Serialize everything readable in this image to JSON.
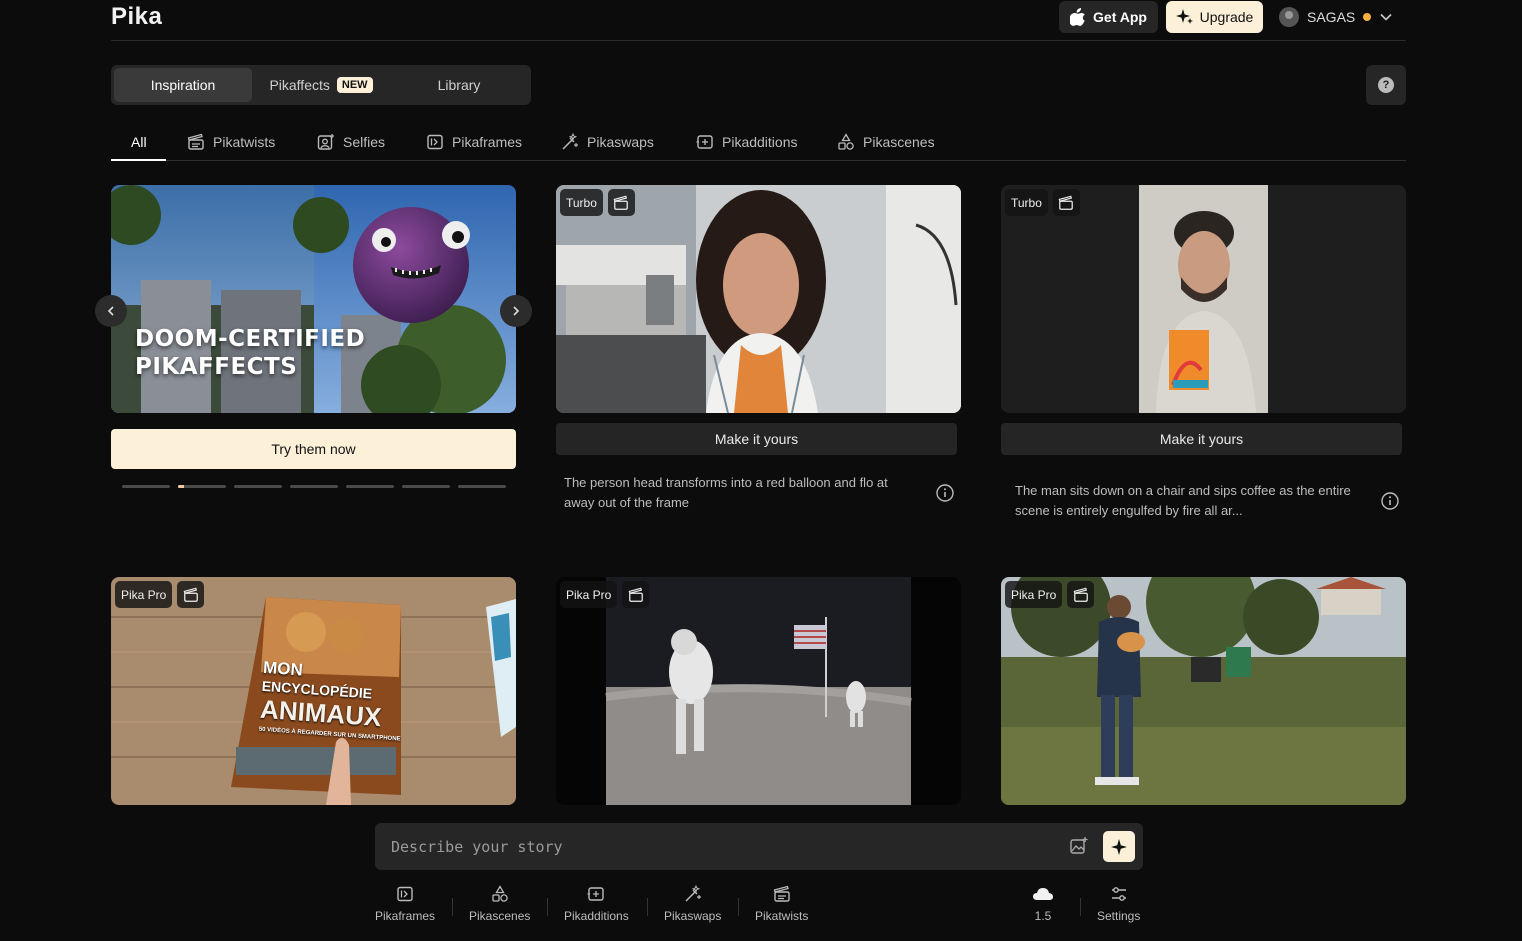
{
  "header": {
    "logo": "Pika",
    "get_app": "Get App",
    "upgrade": "Upgrade",
    "username": "SAGAS"
  },
  "main_tabs": [
    {
      "label": "Inspiration",
      "active": true
    },
    {
      "label": "Pikaffects",
      "badge": "NEW"
    },
    {
      "label": "Library"
    }
  ],
  "help": "?",
  "categories": [
    {
      "label": "All",
      "active": true
    },
    {
      "label": "Pikatwists",
      "icon": "clapper-icon"
    },
    {
      "label": "Selfies",
      "icon": "selfie-icon"
    },
    {
      "label": "Pikaframes",
      "icon": "frames-icon"
    },
    {
      "label": "Pikaswaps",
      "icon": "swap-wand-icon"
    },
    {
      "label": "Pikadditions",
      "icon": "additions-icon"
    },
    {
      "label": "Pikascenes",
      "icon": "shapes-icon"
    }
  ],
  "promo": {
    "title_line1": "DOOM-CERTIFIED",
    "title_line2": "PIKAFFECTS",
    "cta": "Try them now",
    "slide_count": 7,
    "active_slide": 2
  },
  "cards": [
    {
      "tag": "Turbo",
      "action": "Make it yours",
      "description": "The person head transforms into a red balloon and flo at away out of the frame"
    },
    {
      "tag": "Turbo",
      "action": "Make it yours",
      "description": "The man sits down on a chair and sips coffee as the entire scene is entirely engulfed by fire all ar..."
    },
    {
      "tag": "Pika Pro"
    },
    {
      "tag": "Pika Pro"
    },
    {
      "tag": "Pika Pro"
    }
  ],
  "book": {
    "line1": "MON",
    "line2": "ENCYCLOPÉDIE",
    "line3": "ANIMAUX",
    "line4": "50 VIDÉOS À REGARDER SUR UN SMARTPHONE"
  },
  "prompt": {
    "placeholder": "Describe your story"
  },
  "tools": [
    {
      "label": "Pikaframes",
      "icon": "frames-icon"
    },
    {
      "label": "Pikascenes",
      "icon": "shapes-icon"
    },
    {
      "label": "Pikadditions",
      "icon": "additions-icon"
    },
    {
      "label": "Pikaswaps",
      "icon": "swap-wand-icon"
    },
    {
      "label": "Pikatwists",
      "icon": "clapper-icon"
    }
  ],
  "model": {
    "label": "1.5",
    "icon": "cloud-icon"
  },
  "settings": {
    "label": "Settings",
    "icon": "sliders-icon"
  },
  "colors": {
    "accent": "#fdf0d8",
    "background": "#0c0c0c",
    "surface": "#262626"
  }
}
